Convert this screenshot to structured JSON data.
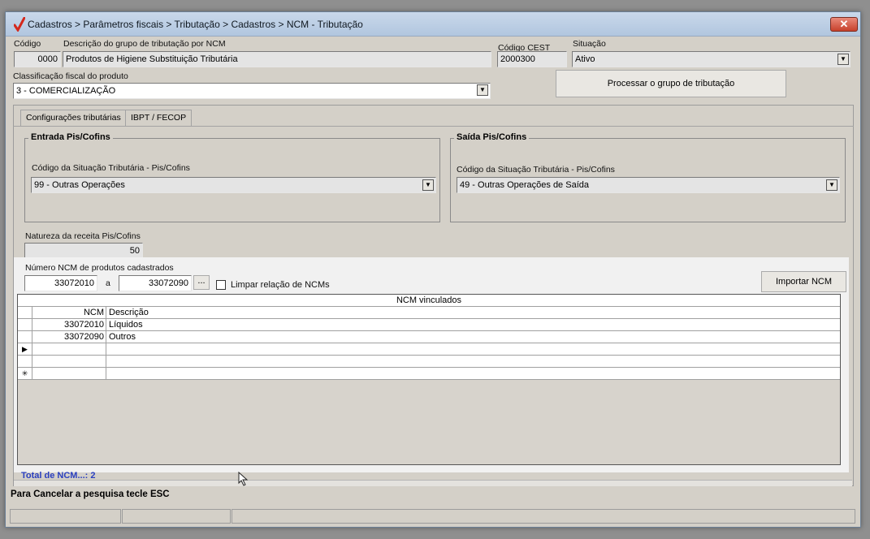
{
  "window": {
    "title": "Cadastros > Parâmetros fiscais > Tributação > Cadastros > NCM - Tributação",
    "close_label": "✕"
  },
  "header": {
    "codigo_label": "Código",
    "codigo_value": "0000",
    "descricao_label": "Descrição do grupo de tributação por NCM",
    "descricao_value": "Produtos de Higiene Substituição Tributária",
    "cest_label": "Código CEST",
    "cest_value": "2000300",
    "situacao_label": "Situação",
    "situacao_value": "Ativo",
    "classificacao_label": "Classificação fiscal do produto",
    "classificacao_value": "3 - COMERCIALIZAÇÃO",
    "processar_button": "Processar o grupo de tributação"
  },
  "tabs": [
    {
      "label": "Configurações tributárias"
    },
    {
      "label": "IBPT / FECOP"
    }
  ],
  "entrada": {
    "title": "Entrada Pis/Cofins",
    "cst_label": "Código da Situação Tributária - Pis/Cofins",
    "cst_value": "99 -  Outras Operações"
  },
  "saida": {
    "title": "Saída Pis/Cofins",
    "cst_label": "Código da Situação Tributária - Pis/Cofins",
    "cst_value": "49 -  Outras Operações de Saída"
  },
  "natureza": {
    "label": "Natureza da receita Pis/Cofins",
    "value": "50"
  },
  "ncm_range": {
    "label": "Número  NCM de produtos cadastrados",
    "from": "33072010",
    "separator": "a",
    "to": "33072090",
    "browse_label": "...",
    "clear_label": "Limpar relação de NCMs",
    "import_button": "Importar NCM"
  },
  "grid": {
    "title": "NCM vinculados",
    "col_ncm": "NCM",
    "col_desc": "Descrição",
    "rows": [
      {
        "ncm": "33072010",
        "desc": "Líquidos"
      },
      {
        "ncm": "33072090",
        "desc": "Outros"
      }
    ],
    "current_marker": "▶",
    "new_marker": "✳"
  },
  "footer": {
    "total": "Total de NCM...: 2",
    "hint": "Para Cancelar a pesquisa tecle ESC"
  },
  "colors": {
    "accent_blue": "#2a3fbf",
    "logo_red": "#d4281c"
  }
}
